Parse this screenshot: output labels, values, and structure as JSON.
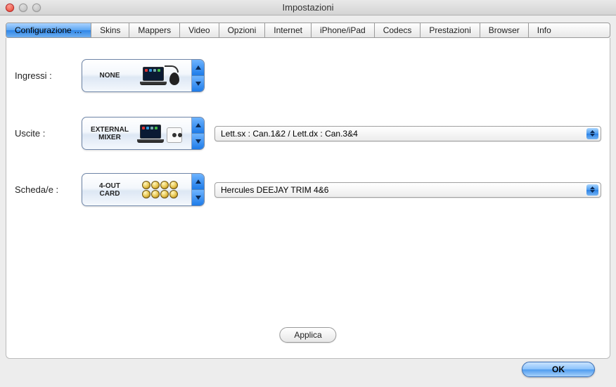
{
  "window": {
    "title": "Impostazioni"
  },
  "tabs": [
    "Configurazione …",
    "Skins",
    "Mappers",
    "Video",
    "Opzioni",
    "Internet",
    "iPhone/iPad",
    "Codecs",
    "Prestazioni",
    "Browser",
    "Info"
  ],
  "active_tab_index": 0,
  "rows": {
    "inputs": {
      "label": "Ingressi :",
      "selector_text": "NONE",
      "icon": "laptop-mouse"
    },
    "outputs": {
      "label": "Uscite :",
      "selector_text": "EXTERNAL\nMIXER",
      "icon": "laptop-mixer",
      "dropdown_value": "Lett.sx : Can.1&2 / Lett.dx : Can.3&4"
    },
    "cards": {
      "label": "Scheda/e :",
      "selector_text": "4-OUT\nCARD",
      "icon": "rca-card",
      "dropdown_value": "Hercules DEEJAY TRIM 4&6"
    }
  },
  "buttons": {
    "apply": "Applica",
    "ok": "OK"
  }
}
